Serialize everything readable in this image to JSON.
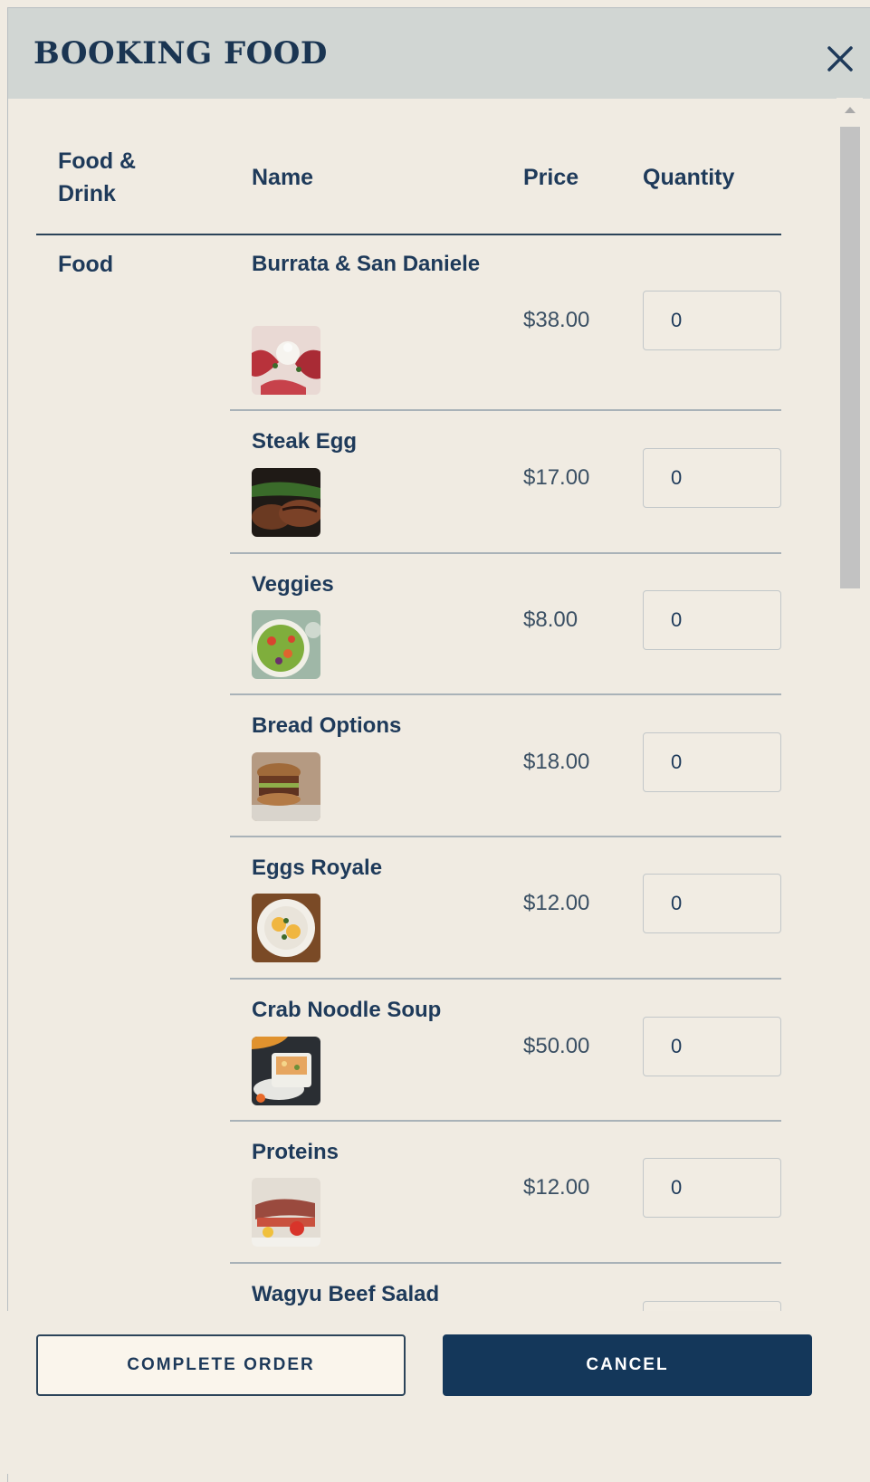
{
  "dialog": {
    "title": "BOOKING FOOD",
    "close_icon": "close-icon"
  },
  "table": {
    "headers": {
      "category": "Food &\nDrink",
      "name": "Name",
      "price": "Price",
      "quantity": "Quantity"
    },
    "category": "Food",
    "items": [
      {
        "name": "Burrata & San Daniele",
        "price": "$38.00",
        "quantity": "0",
        "image": "burrata-image"
      },
      {
        "name": "Steak Egg",
        "price": "$17.00",
        "quantity": "0",
        "image": "steak-image"
      },
      {
        "name": "Veggies",
        "price": "$8.00",
        "quantity": "0",
        "image": "salad-image"
      },
      {
        "name": "Bread Options",
        "price": "$18.00",
        "quantity": "0",
        "image": "sandwich-image"
      },
      {
        "name": "Eggs Royale",
        "price": "$12.00",
        "quantity": "0",
        "image": "eggs-image"
      },
      {
        "name": "Crab Noodle Soup",
        "price": "$50.00",
        "quantity": "0",
        "image": "soup-image"
      },
      {
        "name": "Proteins",
        "price": "$12.00",
        "quantity": "0",
        "image": "proteins-image"
      },
      {
        "name": "Wagyu Beef Salad",
        "price": "",
        "quantity": "",
        "image": ""
      }
    ]
  },
  "footer": {
    "complete_label": "COMPLETE ORDER",
    "cancel_label": "CANCEL"
  },
  "colors": {
    "background": "#f0ebe2",
    "header": "#d1d6d3",
    "primary": "#14375a",
    "text": "#1e3a5a"
  }
}
